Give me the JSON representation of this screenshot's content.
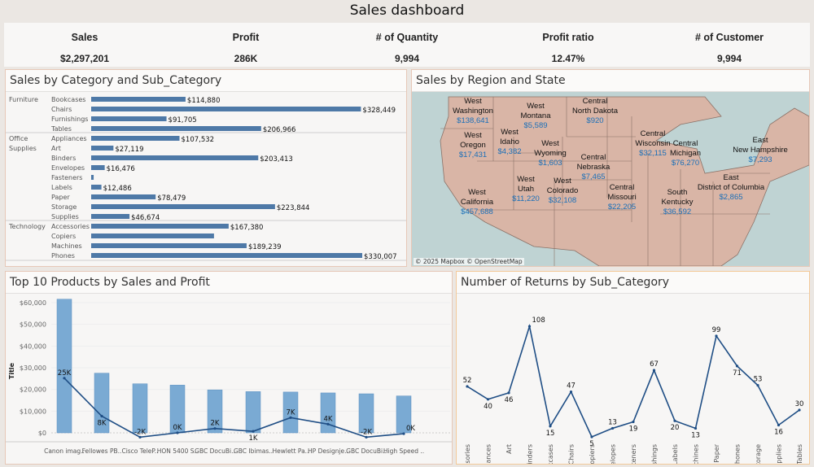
{
  "title": "Sales dashboard",
  "kpis": [
    {
      "label": "Sales",
      "value": "$2,297,201"
    },
    {
      "label": "Profit",
      "value": "286K"
    },
    {
      "label": "# of Quantity",
      "value": "9,994"
    },
    {
      "label": "Profit ratio",
      "value": "12.47%"
    },
    {
      "label": "# of Customer",
      "value": "9,994"
    }
  ],
  "colors": {
    "bar": "#4e79a7",
    "bar_light": "#7aaad3",
    "line": "#1f4e85",
    "map_fill": "#d9b5a6",
    "water": "#bfd3d3",
    "value_text": "#1a6fb8"
  },
  "category_chart": {
    "title": "Sales by Category and Sub_Category",
    "chart_data": {
      "type": "bar",
      "orientation": "horizontal",
      "groups": [
        {
          "category": "Furniture",
          "items": [
            {
              "sub": "Bookcases",
              "value": 114880,
              "label": "$114,880"
            },
            {
              "sub": "Chairs",
              "value": 328449,
              "label": "$328,449"
            },
            {
              "sub": "Furnishings",
              "value": 91705,
              "label": "$91,705"
            },
            {
              "sub": "Tables",
              "value": 206966,
              "label": "$206,966"
            }
          ]
        },
        {
          "category": "Office Supplies",
          "items": [
            {
              "sub": "Appliances",
              "value": 107532,
              "label": "$107,532"
            },
            {
              "sub": "Art",
              "value": 27119,
              "label": "$27,119"
            },
            {
              "sub": "Binders",
              "value": 203413,
              "label": "$203,413"
            },
            {
              "sub": "Envelopes",
              "value": 16476,
              "label": "$16,476"
            },
            {
              "sub": "Fasteners",
              "value": 3024,
              "label": ""
            },
            {
              "sub": "Labels",
              "value": 12486,
              "label": "$12,486"
            },
            {
              "sub": "Paper",
              "value": 78479,
              "label": "$78,479"
            },
            {
              "sub": "Storage",
              "value": 223844,
              "label": "$223,844"
            },
            {
              "sub": "Supplies",
              "value": 46674,
              "label": "$46,674"
            }
          ]
        },
        {
          "category": "Technology",
          "items": [
            {
              "sub": "Accessories",
              "value": 167380,
              "label": "$167,380"
            },
            {
              "sub": "Copiers",
              "value": 149528,
              "label": ""
            },
            {
              "sub": "Machines",
              "value": 189239,
              "label": "$189,239"
            },
            {
              "sub": "Phones",
              "value": 330007,
              "label": "$330,007"
            }
          ]
        }
      ]
    }
  },
  "map": {
    "title": "Sales by Region and State",
    "credit": "© 2025 Mapbox © OpenStreetMap",
    "states": [
      {
        "region": "West",
        "state": "Washington",
        "sales": "$138,641"
      },
      {
        "region": "West",
        "state": "Montana",
        "sales": "$5,589"
      },
      {
        "region": "Central",
        "state": "North Dakota",
        "sales": "$920"
      },
      {
        "region": "West",
        "state": "Oregon",
        "sales": "$17,431"
      },
      {
        "region": "West",
        "state": "Idaho",
        "sales": "$4,382"
      },
      {
        "region": "West",
        "state": "Wyoming",
        "sales": "$1,603"
      },
      {
        "region": "Central",
        "state": "Nebraska",
        "sales": "$7,465"
      },
      {
        "region": "Central",
        "state": "Wisconsin",
        "sales": "$32,115"
      },
      {
        "region": "Central",
        "state": "Michigan",
        "sales": "$76,270"
      },
      {
        "region": "East",
        "state": "New Hampshire",
        "sales": "$7,293"
      },
      {
        "region": "West",
        "state": "Utah",
        "sales": "$11,220"
      },
      {
        "region": "West",
        "state": "Colorado",
        "sales": "$32,108"
      },
      {
        "region": "West",
        "state": "California",
        "sales": "$457,688"
      },
      {
        "region": "Central",
        "state": "Missouri",
        "sales": "$22,205"
      },
      {
        "region": "South",
        "state": "Kentucky",
        "sales": "$36,592"
      },
      {
        "region": "East",
        "state": "District of Columbia",
        "sales": "$2,865"
      }
    ]
  },
  "top10": {
    "title": "Top 10 Products by Sales and Profit",
    "chart_data": {
      "type": "bar+line",
      "ylabel": "Title",
      "ylim": [
        0,
        60000
      ],
      "yticks": [
        "$0",
        "$10,000",
        "$20,000",
        "$30,000",
        "$40,000",
        "$50,000",
        "$60,000"
      ],
      "categories": [
        "Canon imag..",
        "Fellowes PB..",
        "Cisco TeleP..",
        "HON 5400 S..",
        "GBC DocuBi..",
        "GBC Ibimas..",
        "Hewlett Pa..",
        "HP Designje..",
        "GBC DocuBi..",
        "High Speed .."
      ],
      "sales": [
        61600,
        27500,
        22600,
        22000,
        19800,
        19000,
        18800,
        18400,
        18000,
        17000
      ],
      "profit": [
        25200,
        7700,
        -2000,
        0,
        2000,
        700,
        7000,
        4000,
        -2000,
        -400
      ],
      "profit_labels": [
        "25K",
        "8K",
        "-2K",
        "0K",
        "2K",
        "1K",
        "7K",
        "4K",
        "-2K",
        "0K"
      ]
    }
  },
  "returns": {
    "title": "Number of Returns by Sub_Category",
    "chart_data": {
      "type": "line",
      "categories": [
        "Accessories",
        "Appliances",
        "Art",
        "Binders",
        "Bookcases",
        "Chairs",
        "Copiers",
        "Envelopes",
        "Fasteners",
        "Furnishings",
        "Labels",
        "Machines",
        "Paper",
        "Phones",
        "Storage",
        "Supplies",
        "Tables"
      ],
      "values": [
        52,
        40,
        46,
        108,
        15,
        47,
        5,
        13,
        19,
        67,
        20,
        13,
        99,
        71,
        53,
        16,
        30
      ]
    }
  }
}
